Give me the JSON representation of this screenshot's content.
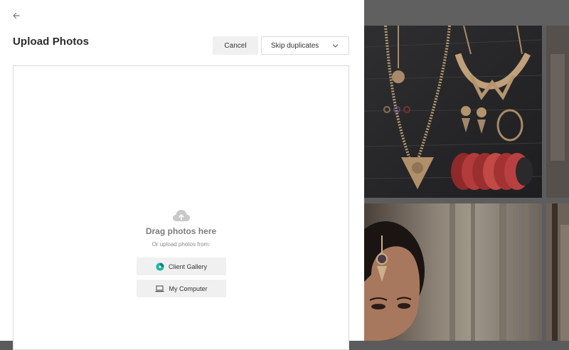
{
  "header": {
    "title": "Upload Photos"
  },
  "actions": {
    "cancel_label": "Cancel",
    "duplicates_selected": "Skip duplicates"
  },
  "dropzone": {
    "heading": "Drag photos here",
    "subtext": "Or upload photos from:",
    "sources": {
      "client_gallery": "Client Gallery",
      "my_computer": "My Computer"
    }
  },
  "icons": {
    "back": "arrow-left-icon",
    "chevron": "chevron-down-icon",
    "cloud": "cloud-upload-icon",
    "gallery": "client-gallery-icon",
    "computer": "laptop-icon"
  },
  "colors": {
    "gallery_accent": "#19b5a7",
    "button_bg": "#f0f0f0"
  }
}
